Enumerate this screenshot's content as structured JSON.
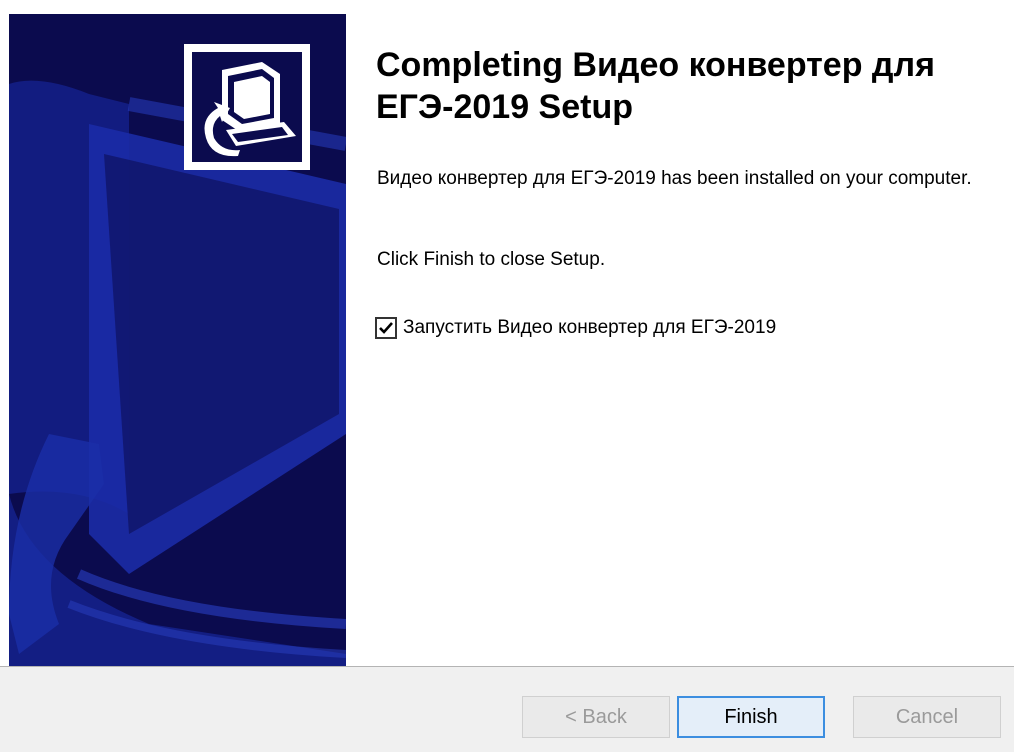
{
  "wizard": {
    "title": "Completing Видео конвертер для ЕГЭ-2019 Setup",
    "description": "Видео конвертер для ЕГЭ-2019 has been installed on your computer.",
    "hint": "Click Finish to close Setup.",
    "run_checkbox": {
      "label": "Запустить Видео конвертер для ЕГЭ-2019",
      "checked": true
    }
  },
  "buttons": {
    "back": "< Back",
    "finish": "Finish",
    "cancel": "Cancel"
  },
  "colors": {
    "banner": "#0b0b4e",
    "banner_accent": "#1a2ea8",
    "footer": "#f0f0f0",
    "focus_border": "#3c8ee0"
  },
  "icons": {
    "logo": "computer-install-icon",
    "check": "checkmark-icon"
  }
}
